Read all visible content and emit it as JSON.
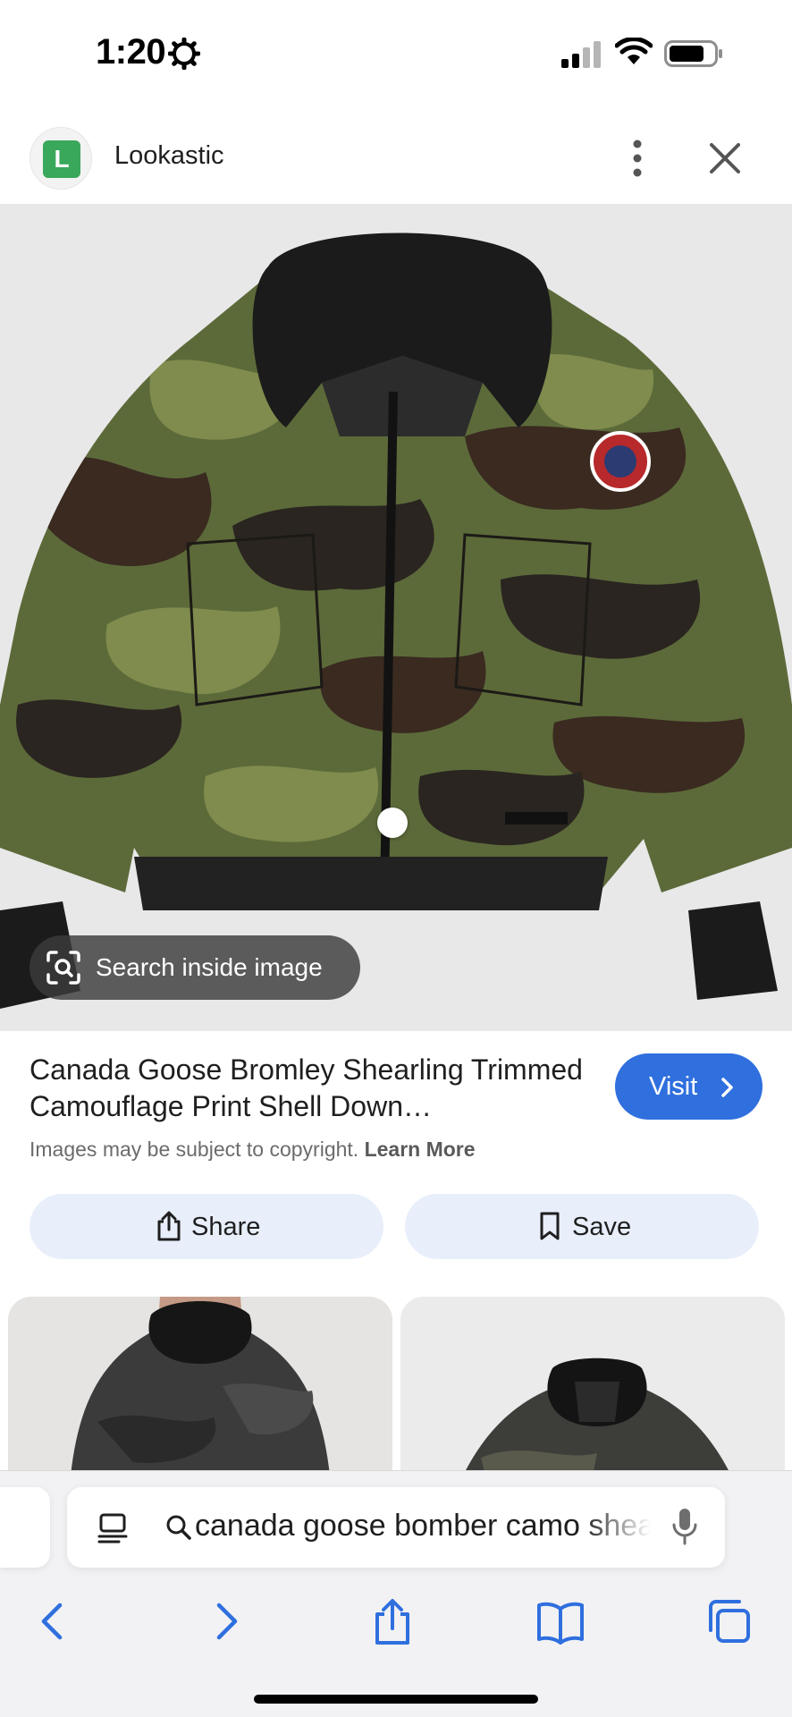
{
  "status_bar": {
    "time": "1:20",
    "icons": [
      "gear-icon",
      "cellular-signal-icon",
      "wifi-icon",
      "battery-icon"
    ]
  },
  "site": {
    "favicon_letter": "L",
    "favicon_color": "#3aa85a",
    "name": "Lookastic",
    "icons": [
      "more-vertical-icon",
      "close-icon"
    ]
  },
  "hero": {
    "lens_chip_label": "Search inside image",
    "lens_icon": "lens-search-icon"
  },
  "result": {
    "title": "Canada Goose Bromley Shearling Trimmed Camouflage Print Shell Down…",
    "visit_label": "Visit",
    "copyright_text": "Images may be subject to copyright.",
    "learn_more": "Learn More",
    "accent_color": "#2f6fde"
  },
  "actions": {
    "share_label": "Share",
    "save_label": "Save"
  },
  "browser": {
    "address_text": "canada goose bomber camo shearling",
    "toolbar": [
      "back-icon",
      "forward-icon",
      "share-icon",
      "bookmarks-icon",
      "tabs-icon"
    ]
  }
}
